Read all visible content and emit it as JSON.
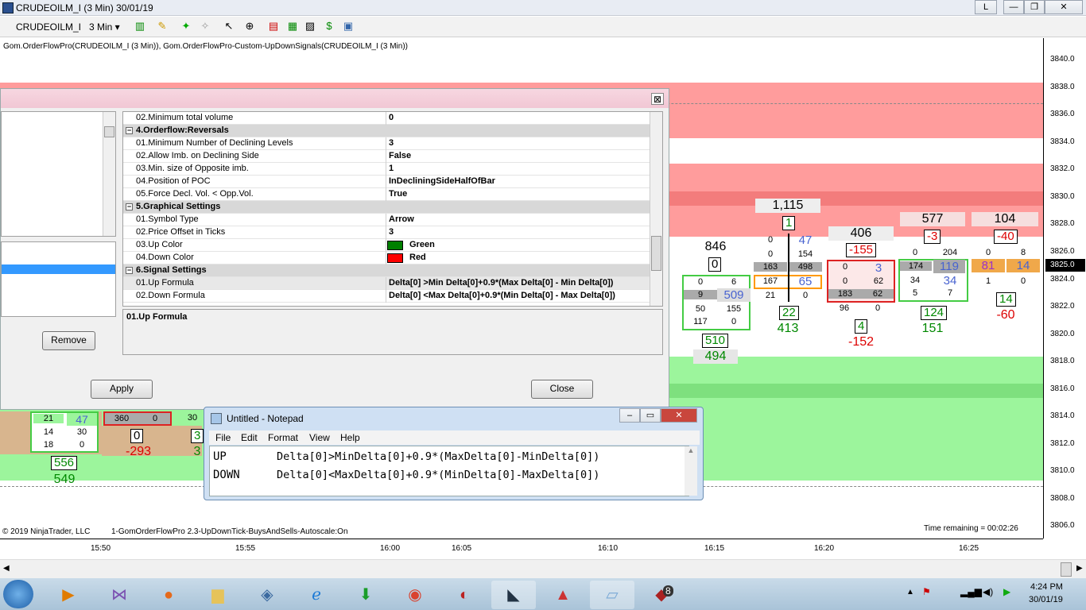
{
  "window": {
    "title": "CRUDEOILM_I (3 Min)  30/01/19",
    "btn_l": "L",
    "btn_min": "—",
    "btn_max": "❐",
    "btn_close": "✕"
  },
  "toolbar": {
    "instrument": "CRUDEOILM_I",
    "interval": "3 Min"
  },
  "chart": {
    "indicator_label": "Gom.OrderFlowPro(CRUDEOILM_I (3 Min)), Gom.OrderFlowPro-Custom-UpDownSignals(CRUDEOILM_I (3 Min))",
    "copyright": "© 2019 NinjaTrader, LLC",
    "footer_label": "1-GomOrderFlowPro 2.3-UpDownTick-BuysAndSells-Autoscale:On",
    "time_remaining": "Time remaining = 00:02:26",
    "price_current": "3825.0",
    "y_ticks": [
      "3840.0",
      "3838.0",
      "3836.0",
      "3834.0",
      "3832.0",
      "3830.0",
      "3828.0",
      "3826.0",
      "3824.0",
      "3822.0",
      "3820.0",
      "3818.0",
      "3816.0",
      "3814.0",
      "3812.0",
      "3810.0",
      "3808.0",
      "3806.0"
    ],
    "x_ticks": [
      "15:50",
      "15:55",
      "16:00",
      "16:05",
      "16:10",
      "16:15",
      "16:20",
      "16:25"
    ],
    "colors": {
      "red_band": "#ff9c9c",
      "dark_red": "#f37c7c",
      "green_band": "#9cf59c",
      "dark_green": "#7ee07e"
    },
    "bars": [
      {
        "total": "846",
        "delta": "0",
        "cells": [
          [
            "0",
            "6"
          ],
          [
            "9",
            "509"
          ],
          [
            "50",
            "155"
          ],
          [
            "117",
            "0"
          ]
        ],
        "vol": "510",
        "vdelta": "494"
      },
      {
        "total": "1,115",
        "delta": "1",
        "cells": [
          [
            "0",
            "47"
          ],
          [
            "0",
            "154"
          ],
          [
            "163",
            "498"
          ],
          [
            "167",
            "65"
          ],
          [
            "21",
            "0"
          ]
        ],
        "vol": "22",
        "vdelta": "413"
      },
      {
        "total": "406",
        "delta": "-155",
        "cells": [
          [
            "0",
            "3"
          ],
          [
            "0",
            "62"
          ],
          [
            "183",
            "62"
          ],
          [
            "96",
            "0"
          ]
        ],
        "vol": "4",
        "vdelta": "-152"
      },
      {
        "total": "577",
        "delta": "-3",
        "cells": [
          [
            "0",
            "204"
          ],
          [
            "174",
            "119"
          ],
          [
            "34",
            "34"
          ],
          [
            "5",
            "7"
          ]
        ],
        "vol": "124",
        "vdelta": "151"
      },
      {
        "total": "104",
        "delta": "-40",
        "cells": [
          [
            "0",
            "8"
          ],
          [
            "81",
            "14"
          ],
          [
            "1",
            "0"
          ]
        ],
        "vol": "14",
        "vdelta": "-60"
      }
    ],
    "left_bars": {
      "c1": [
        "21",
        "47"
      ],
      "c2": [
        "14",
        "30"
      ],
      "c3": [
        "18",
        "0"
      ],
      "vol": "556",
      "vdelta": "549",
      "r1": [
        "360",
        "0"
      ],
      "d1": "0",
      "dv1": "-293",
      "r2": "30",
      "d2": "3",
      "dv2": "3"
    }
  },
  "dialog": {
    "rows": [
      {
        "name": "02.Minimum total volume",
        "value": "0"
      },
      {
        "cat": "4.Orderflow:Reversals"
      },
      {
        "name": "01.Minimum Number of Declining Levels",
        "value": "3"
      },
      {
        "name": "02.Allow Imb. on Declining Side",
        "value": "False"
      },
      {
        "name": "03.Min. size of Opposite imb.",
        "value": "1"
      },
      {
        "name": "04.Position of POC",
        "value": "InDecliningSideHalfOfBar"
      },
      {
        "name": "05.Force Decl. Vol. < Opp.Vol.",
        "value": "True"
      },
      {
        "cat": "5.Graphical Settings"
      },
      {
        "name": "01.Symbol Type",
        "value": "Arrow"
      },
      {
        "name": "02.Price Offset in Ticks",
        "value": "3"
      },
      {
        "name": "03.Up Color",
        "value": "Green",
        "swatch": "#008000"
      },
      {
        "name": "04.Down Color",
        "value": "Red",
        "swatch": "#ff0000"
      },
      {
        "cat": "6.Signal Settings"
      },
      {
        "name": "01.Up Formula",
        "value": "Delta[0] >Min Delta[0]+0.9*(Max Delta[0] - Min Delta[0])",
        "sel": true
      },
      {
        "name": "02.Down Formula",
        "value": "Delta[0] <Max Delta[0]+0.9*(Min Delta[0] - Max Delta[0])"
      }
    ],
    "description_title": "01.Up Formula",
    "remove_label": "Remove",
    "apply_label": "Apply",
    "close_label": "Close",
    "close_x": "⊠"
  },
  "notepad": {
    "title": "Untitled - Notepad",
    "menu": [
      "File",
      "Edit",
      "Format",
      "View",
      "Help"
    ],
    "line1_key": "UP",
    "line1_val": "Delta[0]>MinDelta[0]+0.9*(MaxDelta[0]-MinDelta[0])",
    "line2_key": "DOWN",
    "line2_val": "Delta[0]<MaxDelta[0]+0.9*(MinDelta[0]-MaxDelta[0])"
  },
  "taskbar": {
    "time": "4:24 PM",
    "date": "30/01/19",
    "badge": "8"
  }
}
